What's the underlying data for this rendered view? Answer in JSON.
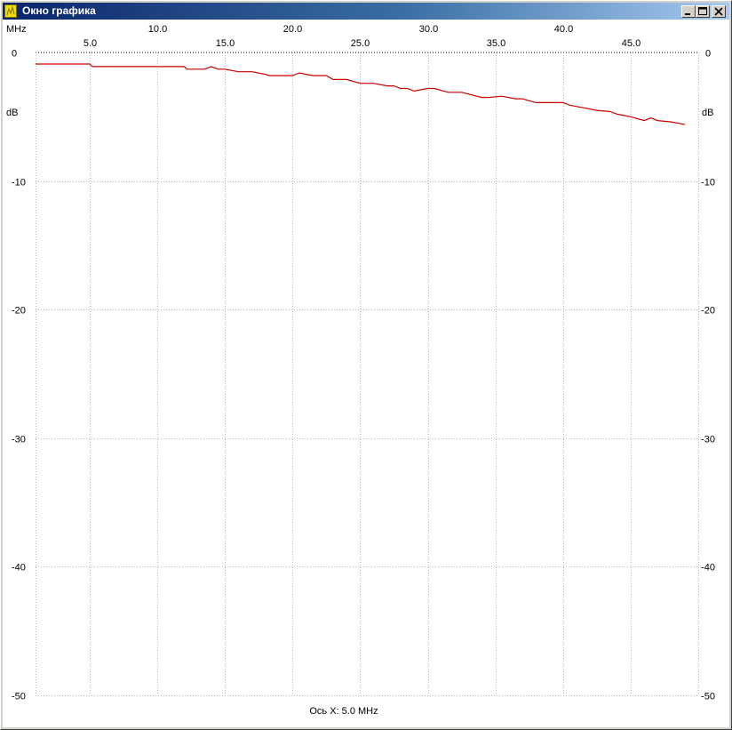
{
  "window": {
    "title": "Окно графика",
    "icon": "chart-app-icon",
    "buttons": {
      "minimize": "minimize-icon",
      "maximize": "maximize-icon",
      "close": "close-icon"
    }
  },
  "chart_data": {
    "type": "line",
    "x_unit": "MHz",
    "y_unit": "dB",
    "x_ticks": [
      "5.0",
      "10.0",
      "15.0",
      "20.0",
      "25.0",
      "30.0",
      "35.0",
      "40.0",
      "45.0"
    ],
    "x_tick_values": [
      5,
      10,
      15,
      20,
      25,
      30,
      35,
      40,
      45
    ],
    "y_ticks": [
      "0",
      "-10",
      "-20",
      "-30",
      "-40",
      "-50"
    ],
    "y_tick_values": [
      0,
      -10,
      -20,
      -30,
      -40,
      -50
    ],
    "xlim": [
      1,
      50
    ],
    "ylim": [
      -50,
      0
    ],
    "grid": true,
    "footer": "Ось X: 5.0 MHz",
    "series": [
      {
        "color": "#cc0000",
        "x": [
          1,
          5,
          5.2,
          12,
          12.2,
          13.5,
          14,
          14.5,
          15,
          16,
          17,
          18,
          18.3,
          20,
          20.5,
          21.5,
          22.5,
          23,
          24,
          25,
          26,
          27,
          27.5,
          28,
          28.5,
          29,
          30,
          30.5,
          31.5,
          32.5,
          34,
          34.5,
          35.5,
          36.5,
          37,
          38,
          39,
          40,
          40.5,
          41.5,
          42.5,
          43.5,
          44,
          45,
          46,
          46.5,
          47,
          48,
          49
        ],
        "y": [
          -0.9,
          -0.9,
          -1.1,
          -1.1,
          -1.3,
          -1.3,
          -1.1,
          -1.3,
          -1.3,
          -1.5,
          -1.5,
          -1.7,
          -1.8,
          -1.8,
          -1.6,
          -1.8,
          -1.8,
          -2.1,
          -2.1,
          -2.4,
          -2.4,
          -2.6,
          -2.6,
          -2.8,
          -2.8,
          -3.0,
          -2.8,
          -2.8,
          -3.1,
          -3.1,
          -3.5,
          -3.5,
          -3.4,
          -3.6,
          -3.6,
          -3.9,
          -3.9,
          -3.9,
          -4.1,
          -4.3,
          -4.5,
          -4.6,
          -4.8,
          -5.0,
          -5.3,
          -5.1,
          -5.3,
          -5.4,
          -5.6
        ]
      }
    ]
  }
}
